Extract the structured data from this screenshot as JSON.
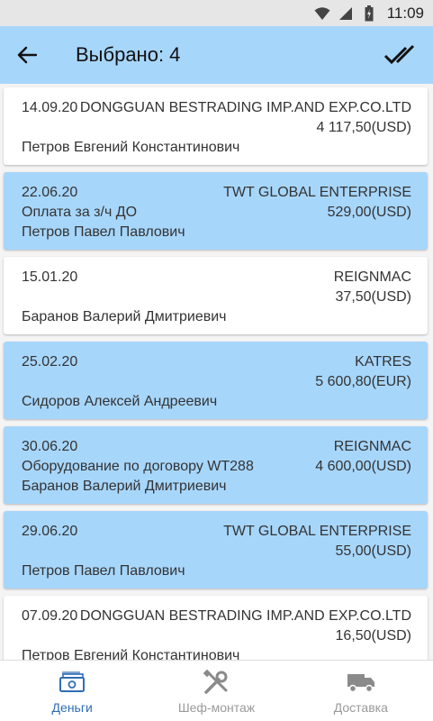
{
  "status_bar": {
    "time": "11:09"
  },
  "app_bar": {
    "title": "Выбрано: 4"
  },
  "items": [
    {
      "date": "14.09.20",
      "company": "DONGGUAN BESTRADING IMP.AND EXP.CO.LTD",
      "amount": "4 117,50(USD)",
      "purpose": "",
      "person": "Петров Евгений Константинович",
      "selected": false
    },
    {
      "date": "22.06.20",
      "company": "TWT GLOBAL ENTERPRISE",
      "amount": "529,00(USD)",
      "purpose": "Оплата за з/ч ДО",
      "person": "Петров Павел Павлович",
      "selected": true
    },
    {
      "date": "15.01.20",
      "company": "REIGNMAC",
      "amount": "37,50(USD)",
      "purpose": "",
      "person": "Баранов Валерий Дмитриевич",
      "selected": false
    },
    {
      "date": "25.02.20",
      "company": "KATRES",
      "amount": "5 600,80(EUR)",
      "purpose": "",
      "person": "Сидоров Алексей Андреевич",
      "selected": true
    },
    {
      "date": "30.06.20",
      "company": "REIGNMAC",
      "amount": "4 600,00(USD)",
      "purpose": "Оборудование по договору WT288",
      "person": "Баранов Валерий Дмитриевич",
      "selected": true
    },
    {
      "date": "29.06.20",
      "company": "TWT GLOBAL ENTERPRISE",
      "amount": "55,00(USD)",
      "purpose": "",
      "person": "Петров Павел Павлович",
      "selected": true
    },
    {
      "date": "07.09.20",
      "company": "DONGGUAN BESTRADING IMP.AND EXP.CO.LTD",
      "amount": "16,50(USD)",
      "purpose": "",
      "person": "Петров Евгений Константинович",
      "selected": false
    }
  ],
  "bottom_nav": [
    {
      "label": "Деньги",
      "icon": "money-icon",
      "active": true
    },
    {
      "label": "Шеф-монтаж",
      "icon": "tools-icon",
      "active": false
    },
    {
      "label": "Доставка",
      "icon": "truck-icon",
      "active": false
    }
  ],
  "colors": {
    "app_bar": "#a7d6fb",
    "selected_card": "#a7d6fb",
    "active_nav": "#2f6db5",
    "inactive_nav": "#9a9a9a"
  }
}
